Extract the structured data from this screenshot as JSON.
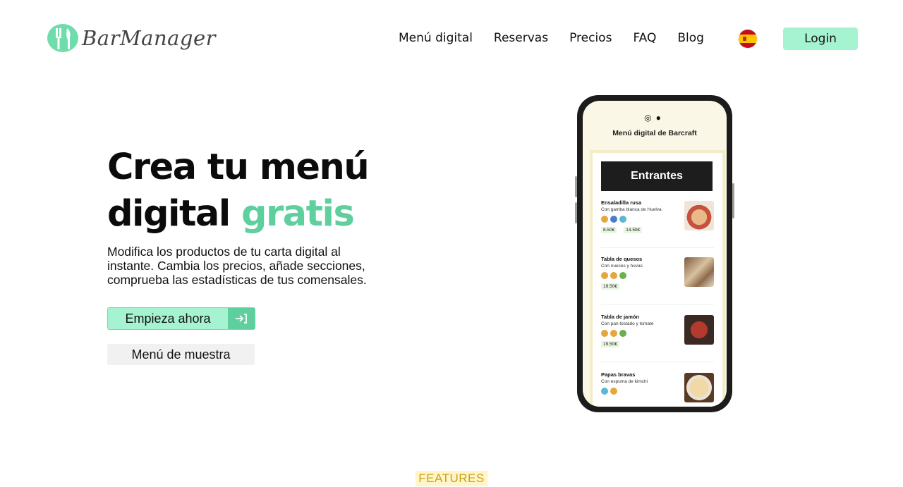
{
  "brand": {
    "name": "BarManager"
  },
  "nav": {
    "items": [
      "Menú digital",
      "Reservas",
      "Precios",
      "FAQ",
      "Blog"
    ],
    "language_flag": "spain-flag-icon",
    "login_label": "Login"
  },
  "hero": {
    "title_line1": "Crea tu menú",
    "title_line2_plain": "digital ",
    "title_line2_accent": "gratis",
    "subtitle": "Modifica los productos de tu carta digital al instante. Cambia los precios, añade secciones, comprueba las estadísticas de tus comensales.",
    "primary_button": "Empieza ahora",
    "secondary_button": "Menú de muestra"
  },
  "phone_preview": {
    "menu_title": "Menú digital de Barcraft",
    "section": "Entrantes",
    "dishes": [
      {
        "name": "Ensaladilla rusa",
        "desc": "Con gamba blanca de Huelva",
        "prices": [
          "8.50€",
          "14.50€"
        ]
      },
      {
        "name": "Tabla de quesos",
        "desc": "Con nueces y huvas",
        "prices": [
          "19.50€"
        ]
      },
      {
        "name": "Tabla de jamón",
        "desc": "Con pan tostado y tomate",
        "prices": [
          "19.50€"
        ]
      },
      {
        "name": "Papas bravas",
        "desc": "Con espuma de kimchi",
        "prices": []
      }
    ]
  },
  "features_badge": "FEATURES",
  "colors": {
    "accent": "#5fcf9e",
    "button_bg": "#a6f3d1",
    "features_bg": "#fff5c8",
    "features_text": "#c9a31c"
  }
}
